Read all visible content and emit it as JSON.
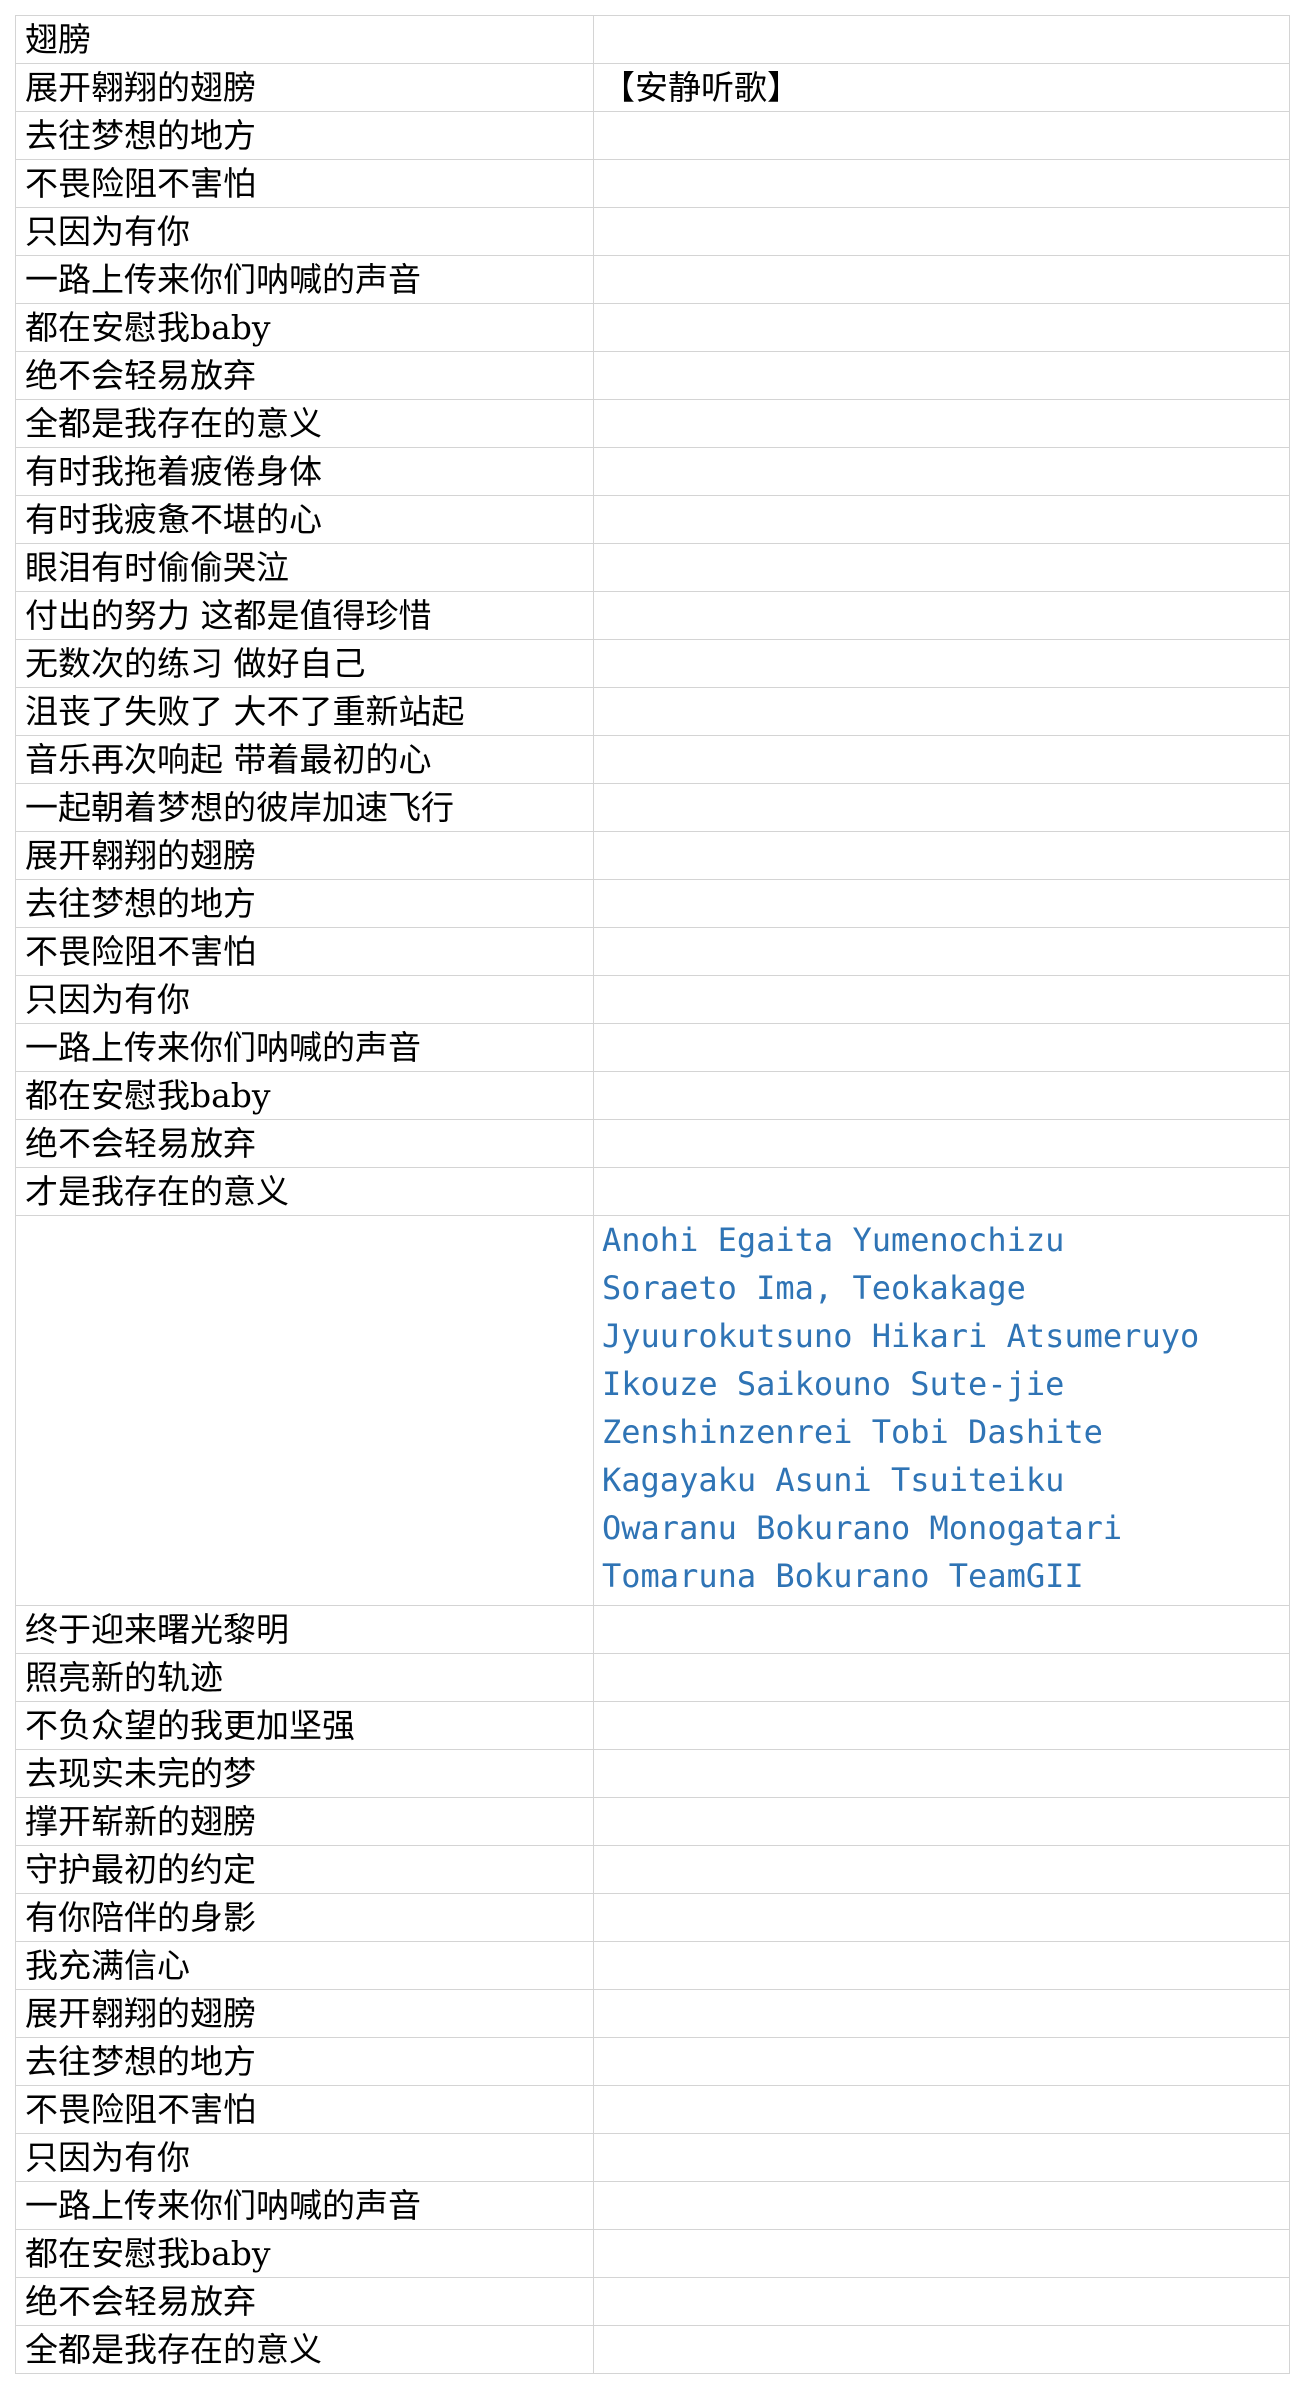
{
  "sheet": {
    "header_note": "【安静听歌】",
    "colors": {
      "note": "#00b050",
      "romaji": "#2f74b5",
      "grid": "#d4d4d4"
    },
    "lyrics_part1": [
      "翅膀",
      "展开翱翔的翅膀",
      "去往梦想的地方",
      "不畏险阻不害怕",
      "只因为有你",
      "一路上传来你们呐喊的声音",
      "都在安慰我baby",
      "绝不会轻易放弃",
      "全都是我存在的意义",
      "有时我拖着疲倦身体",
      "有时我疲惫不堪的心",
      "眼泪有时偷偷哭泣",
      "付出的努力 这都是值得珍惜",
      "无数次的练习 做好自己",
      "沮丧了失败了 大不了重新站起",
      "音乐再次响起 带着最初的心",
      "一起朝着梦想的彼岸加速飞行",
      "展开翱翔的翅膀",
      "去往梦想的地方",
      "不畏险阻不害怕",
      "只因为有你",
      "一路上传来你们呐喊的声音",
      "都在安慰我baby",
      "绝不会轻易放弃",
      "才是我存在的意义"
    ],
    "romaji_lines": [
      "Anohi Egaita Yumenochizu",
      "Soraeto Ima, Teokakage",
      "Jyuurokutsuno Hikari Atsumeruyo",
      "Ikouze Saikouno Sute-jie",
      "Zenshinzenrei Tobi Dashite",
      "Kagayaku Asuni Tsuiteiku",
      "Owaranu Bokurano Monogatari",
      "Tomaruna Bokurano TeamGII"
    ],
    "lyrics_part2": [
      "终于迎来曙光黎明",
      "照亮新的轨迹",
      "不负众望的我更加坚强",
      "去现实未完的梦",
      "撑开崭新的翅膀",
      "守护最初的约定",
      "有你陪伴的身影",
      "我充满信心",
      "展开翱翔的翅膀",
      "去往梦想的地方",
      "不畏险阻不害怕",
      "只因为有你",
      "一路上传来你们呐喊的声音",
      "都在安慰我baby",
      "绝不会轻易放弃",
      "全都是我存在的意义"
    ]
  }
}
